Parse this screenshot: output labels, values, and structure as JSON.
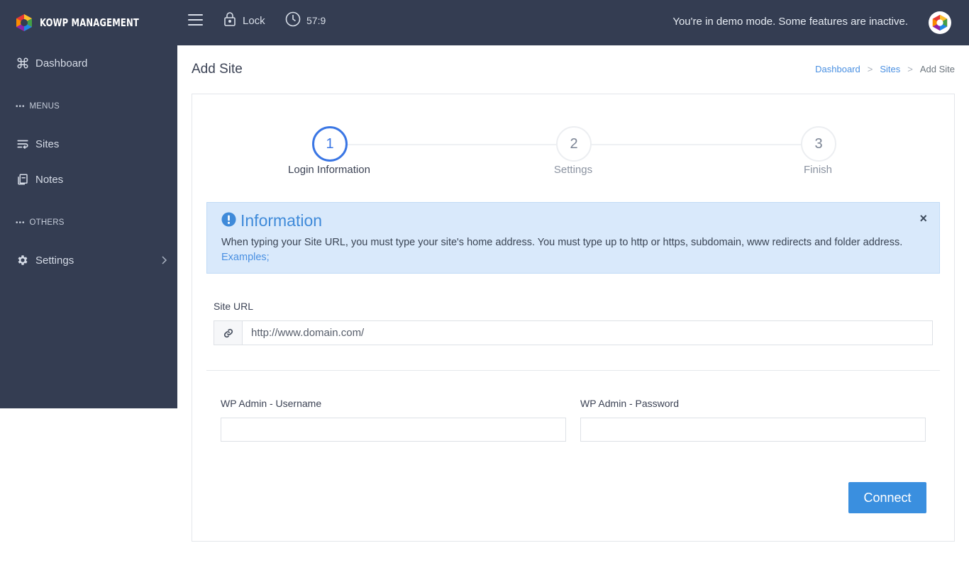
{
  "brand": {
    "name": "KOWP MANAGEMENT"
  },
  "sidebar": {
    "dashboard": "Dashboard",
    "section_menus": "MENUS",
    "sites": "Sites",
    "notes": "Notes",
    "section_others": "OTHERS",
    "settings": "Settings"
  },
  "topbar": {
    "lock": "Lock",
    "timer": "57:9",
    "demo_notice": "You're in demo mode. Some features are inactive."
  },
  "page": {
    "title": "Add Site",
    "breadcrumb": [
      "Dashboard",
      "Sites",
      "Add Site"
    ]
  },
  "wizard": {
    "steps": [
      {
        "number": "1",
        "label": "Login Information",
        "active": true
      },
      {
        "number": "2",
        "label": "Settings",
        "active": false
      },
      {
        "number": "3",
        "label": "Finish",
        "active": false
      }
    ]
  },
  "info": {
    "title": "Information",
    "close": "×",
    "body": "When typing your Site URL, you must type your site's home address. You must type up to http or https, subdomain, www redirects and folder address.",
    "link": "Examples;"
  },
  "form": {
    "site_url_label": "Site URL",
    "site_url_value": "http://www.domain.com/",
    "username_label": "WP Admin - Username",
    "username_value": "",
    "password_label": "WP Admin - Password",
    "password_value": "",
    "connect_label": "Connect"
  },
  "colors": {
    "sidebar_bg": "#343d52",
    "accent": "#3a8fdf",
    "info_bg": "#d9e9fb",
    "step_active": "#3a76e4"
  },
  "icons": {
    "dashboard": "command-icon",
    "sites": "wrap-lines-icon",
    "notes": "copy-file-icon",
    "settings": "gear-icon",
    "lock": "lock-icon",
    "timer": "clock-icon",
    "info": "exclamation-circle-icon",
    "url": "link-icon"
  }
}
